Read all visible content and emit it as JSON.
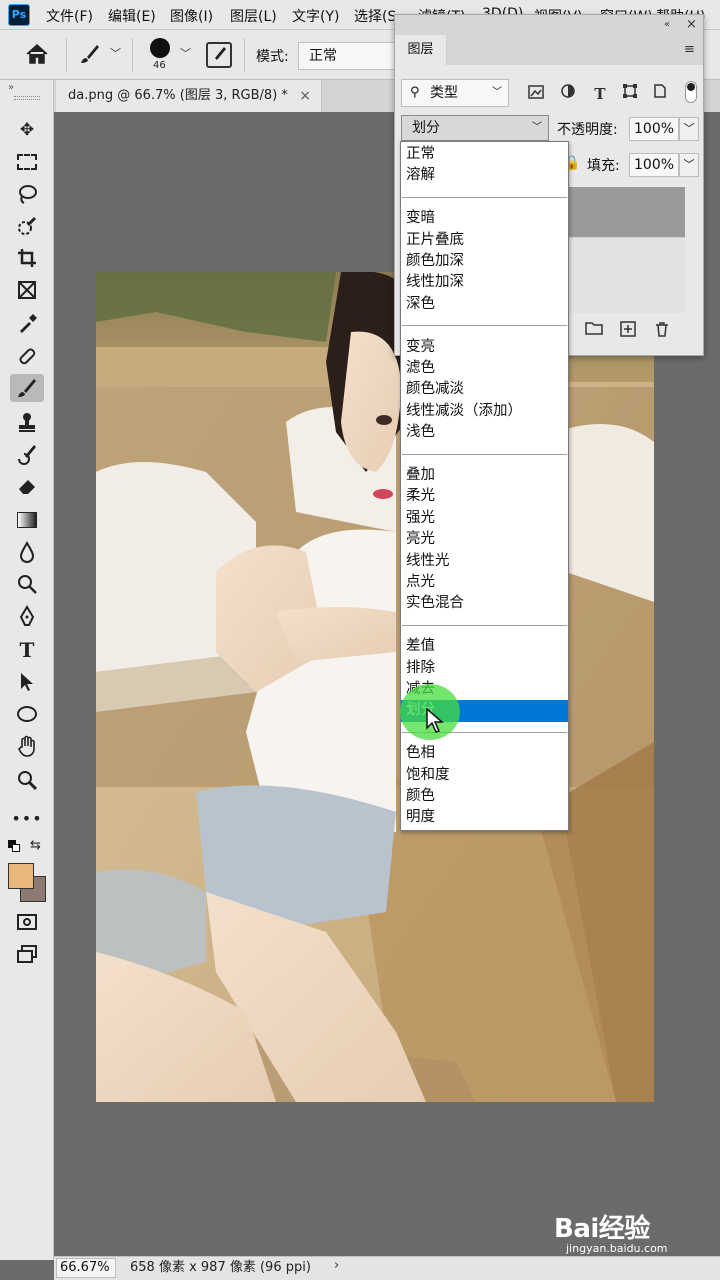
{
  "menubar": {
    "logo": "Ps",
    "items": [
      "文件(F)",
      "编辑(E)",
      "图像(I)",
      "图层(L)",
      "文字(Y)",
      "选择(S",
      "滤镜(T)",
      "3D(D)",
      "视图(V)",
      "窗口(W)",
      "帮助(H)"
    ]
  },
  "options": {
    "brush_size": "46",
    "mode_label": "模式:",
    "mode_value": "正常"
  },
  "document": {
    "tab_title": "da.png @ 66.7% (图层 3, RGB/8) *",
    "close_glyph": "×"
  },
  "layers_panel": {
    "tab_label": "图层",
    "filter_value": "类型",
    "blend_value": "划分",
    "opacity_label": "不透明度:",
    "opacity_value": "100%",
    "fill_label": "填充:",
    "fill_value": "100%",
    "panel_close": "×",
    "panel_collapse": "«",
    "panel_menu": "≡"
  },
  "blend_dropdown": {
    "items": [
      [
        "正常",
        "溶解"
      ],
      [
        "变暗",
        "正片叠底",
        "颜色加深",
        "线性加深",
        "深色"
      ],
      [
        "变亮",
        "滤色",
        "颜色减淡",
        "线性减淡（添加）",
        "浅色"
      ],
      [
        "叠加",
        "柔光",
        "强光",
        "亮光",
        "线性光",
        "点光",
        "实色混合"
      ],
      [
        "差值",
        "排除",
        "减去",
        "划分"
      ],
      [
        "色相",
        "饱和度",
        "颜色",
        "明度"
      ]
    ],
    "selected": "划分"
  },
  "status": {
    "zoom": "66.67%",
    "doc_size": "658 像素 x 987 像素 (96 ppi)",
    "arrow": "›"
  },
  "watermark": {
    "logo": "Bai经验",
    "url": "jingyan.baidu.com"
  },
  "colors": {
    "foreground": "#e8b87a",
    "background": "#8a7a72",
    "selection": "#0078d7",
    "highlight": "#46dc3c"
  }
}
